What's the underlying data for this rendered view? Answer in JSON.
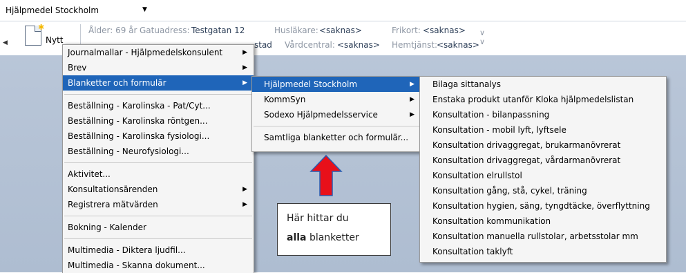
{
  "topbar": {
    "selector_value": "Hjälpmedel Stockholm",
    "selector_icon": "dropdown-arrow-icon"
  },
  "toolbar": {
    "new_label": "Nytt",
    "age": "Ålder: 69 år",
    "street_label": "Gatuadress:",
    "street_value": "Testgatan 12",
    "doctor_label": "Husläkare:",
    "doctor_value": "<saknas>",
    "free_label": "Frikort:",
    "free_value": "<saknas>",
    "city_value": "stad",
    "center_label": "Vårdcentral:",
    "center_value": "<saknas>",
    "homecare_label": "Hemtjänst:",
    "homecare_value": "<saknas>"
  },
  "menu1": [
    {
      "label": "Journalmallar - Hjälpmedelskonsulent",
      "sub": true
    },
    {
      "label": "Brev",
      "sub": true
    },
    {
      "label": "Blanketter och formulär",
      "sub": true,
      "highlight": true
    },
    {
      "sep": true
    },
    {
      "label": "Beställning - Karolinska - Pat/Cyt..."
    },
    {
      "label": "Beställning - Karolinska röntgen..."
    },
    {
      "label": "Beställning - Karolinska fysiologi..."
    },
    {
      "label": "Beställning - Neurofysiologi..."
    },
    {
      "sep": true
    },
    {
      "label": "Aktivitet..."
    },
    {
      "label": "Konsultationsärenden",
      "sub": true
    },
    {
      "label": "Registrera mätvärden",
      "sub": true
    },
    {
      "sep": true
    },
    {
      "label": "Bokning - Kalender"
    },
    {
      "sep": true
    },
    {
      "label": "Multimedia - Diktera ljudfil..."
    },
    {
      "label": "Multimedia - Skanna dokument..."
    }
  ],
  "menu2": [
    {
      "label": "Hjälpmedel Stockholm",
      "sub": true,
      "highlight": true
    },
    {
      "label": "KommSyn",
      "sub": true
    },
    {
      "label": "Sodexo Hjälpmedelsservice",
      "sub": true
    },
    {
      "sep": true
    },
    {
      "label": "Samtliga blanketter och formulär..."
    }
  ],
  "menu3": [
    {
      "label": "Bilaga sittanalys"
    },
    {
      "label": "Enstaka produkt utanför Kloka hjälpmedelslistan"
    },
    {
      "label": "Konsultation - bilanpassning"
    },
    {
      "label": "Konsultation - mobil lyft, lyftsele"
    },
    {
      "label": "Konsultation drivaggregat, brukarmanövrerat"
    },
    {
      "label": "Konsultation drivaggregat, vårdarmanövrerat"
    },
    {
      "label": "Konsultation elrullstol"
    },
    {
      "label": "Konsultation gång, stå, cykel, träning"
    },
    {
      "label": "Konsultation hygien, säng, tyngdtäcke, överflyttning"
    },
    {
      "label": "Konsultation kommunikation"
    },
    {
      "label": "Konsultation manuella rullstolar, arbetsstolar mm"
    },
    {
      "label": "Konsultation taklyft"
    }
  ],
  "callout": {
    "line1": "Här hittar du",
    "bold_word": "alla",
    "rest": " blanketter"
  },
  "colors": {
    "highlight": "#1f65b9",
    "arrow": "#e8101a",
    "workspace": "#b9c6d8"
  }
}
